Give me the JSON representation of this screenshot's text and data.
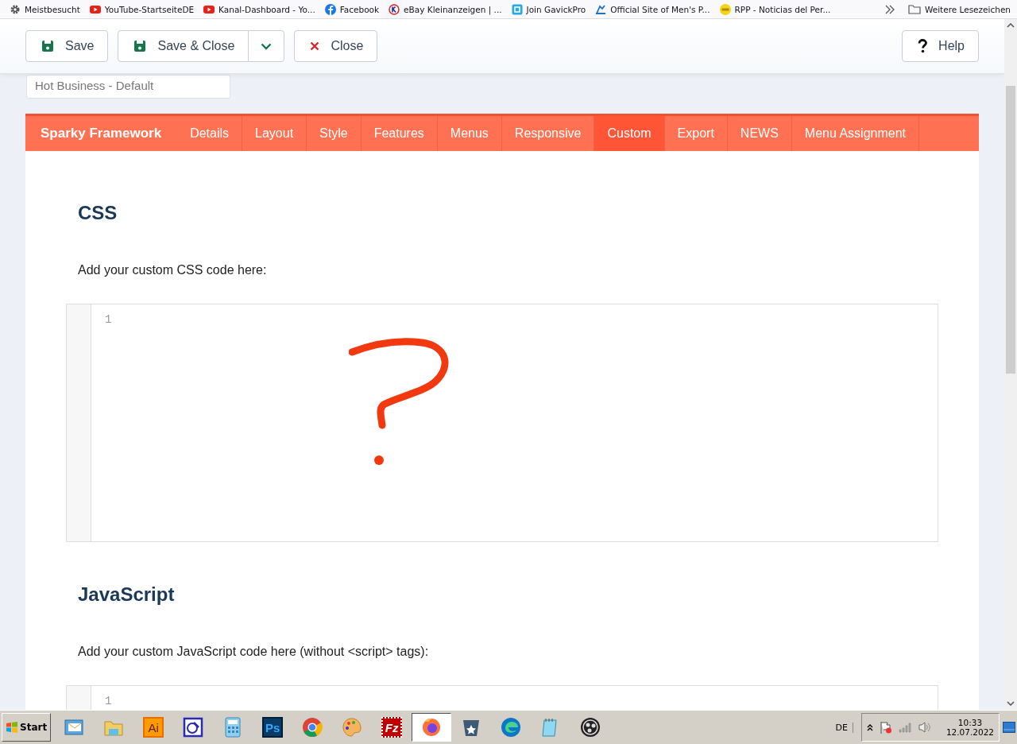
{
  "bookmarks": [
    {
      "label": "Meistbesucht",
      "kind": "gear"
    },
    {
      "label": "YouTube-StartseiteDE",
      "kind": "video"
    },
    {
      "label": "Kanal-Dashboard - Yo...",
      "kind": "video"
    },
    {
      "label": "Facebook",
      "kind": "letter-f"
    },
    {
      "label": "eBay Kleinanzeigen | ...",
      "kind": "letter-k"
    },
    {
      "label": "Join GavickPro",
      "kind": "square"
    },
    {
      "label": "Official Site of Men's P...",
      "kind": "player"
    },
    {
      "label": "RPP - Noticias del Per...",
      "kind": "yellow"
    }
  ],
  "more_bookmarks": {
    "label": "Weitere Lesezeichen"
  },
  "toolbar": {
    "buttons": [
      {
        "label": "Save",
        "kind": "save"
      },
      {
        "label": "Save & Close",
        "kind": "save-split"
      },
      {
        "label": "Close",
        "kind": "close"
      }
    ],
    "help": {
      "label": "Help"
    }
  },
  "style_field": {
    "value": "Hot Business - Default"
  },
  "tabs_bar": {
    "brand": "Sparky Framework",
    "tabs": [
      {
        "label": "Details",
        "selected": false
      },
      {
        "label": "Layout",
        "selected": false
      },
      {
        "label": "Style",
        "selected": false
      },
      {
        "label": "Features",
        "selected": false
      },
      {
        "label": "Menus",
        "selected": false
      },
      {
        "label": "Responsive",
        "selected": false
      },
      {
        "label": "Custom",
        "selected": true
      },
      {
        "label": "Export",
        "selected": false
      },
      {
        "label": "NEWS",
        "selected": false
      },
      {
        "label": "Menu Assignment",
        "selected": false
      }
    ]
  },
  "sections": [
    {
      "heading": "CSS",
      "description": "Add your custom CSS code here:",
      "line_number": "1"
    },
    {
      "heading": "JavaScript",
      "description": "Add your custom JavaScript code here (without <script> tags):",
      "line_number": "1"
    }
  ],
  "taskbar": {
    "start": "Start",
    "apps": [
      {
        "kind": "mail",
        "active": false
      },
      {
        "kind": "folder",
        "active": false
      },
      {
        "kind": "ai",
        "label": "Ai",
        "active": false
      },
      {
        "kind": "tool",
        "active": false
      },
      {
        "kind": "calc",
        "active": false
      },
      {
        "kind": "ps",
        "label": "Ps",
        "active": false
      },
      {
        "kind": "chrome",
        "active": false
      },
      {
        "kind": "palette",
        "active": false
      },
      {
        "kind": "fz",
        "label": "Fz",
        "active": false
      },
      {
        "kind": "firefox",
        "active": true
      },
      {
        "kind": "star",
        "active": false
      },
      {
        "kind": "edge",
        "active": false
      },
      {
        "kind": "notepad",
        "active": false
      },
      {
        "kind": "obs",
        "active": false
      }
    ],
    "language": "DE",
    "time": "10:33",
    "date": "12.07.2022"
  }
}
